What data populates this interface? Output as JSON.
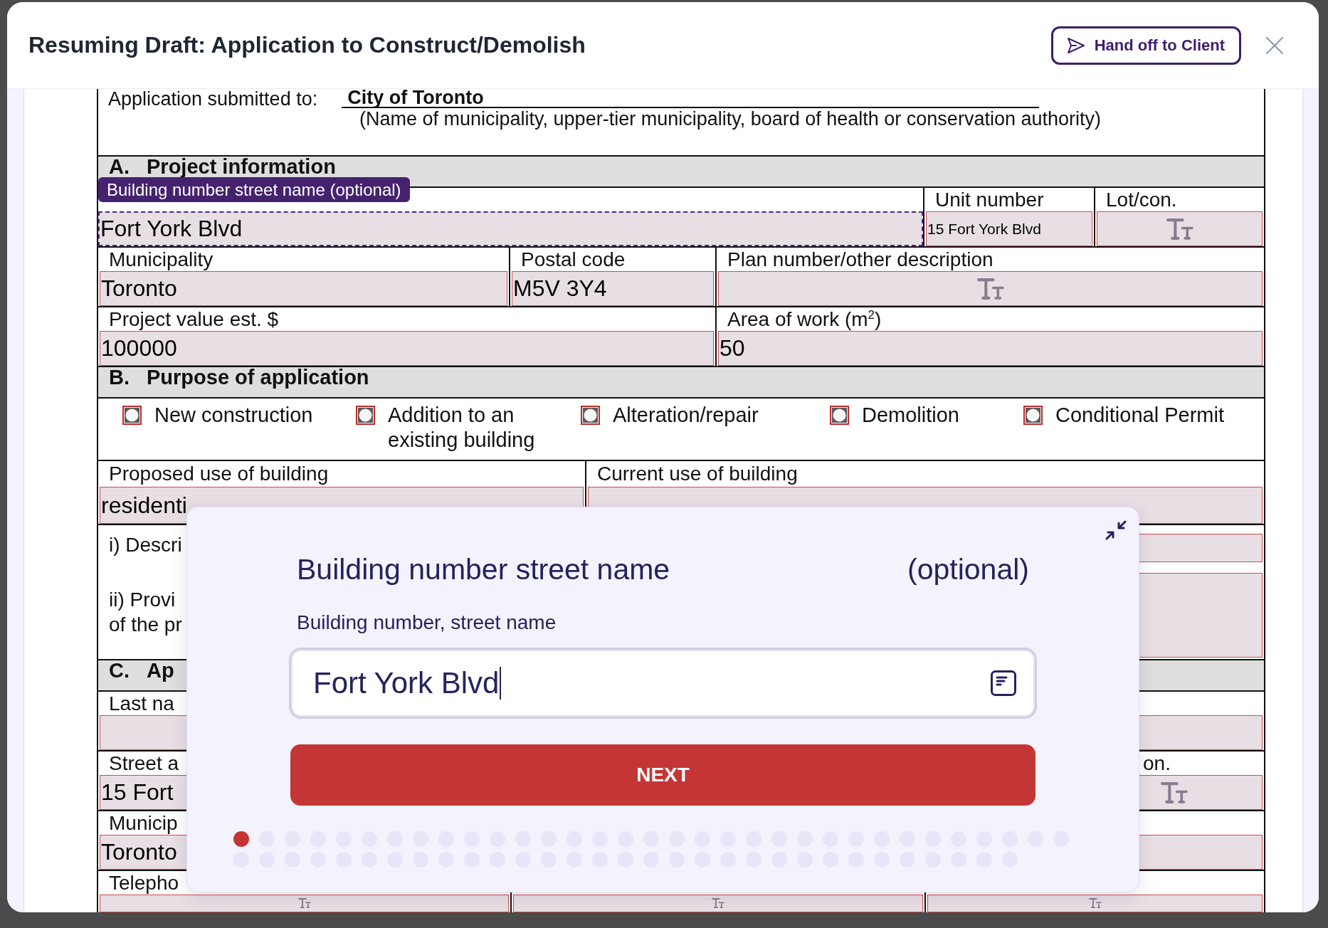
{
  "header": {
    "title": "Resuming Draft: Application to Construct/Demolish",
    "hand_off_button": "Hand off to Client"
  },
  "form": {
    "submitted_to": {
      "label": "Application submitted to:",
      "value": "City of Toronto",
      "note": "(Name of municipality, upper-tier municipality, board of health or conservation authority)"
    },
    "rows": [
      {
        "kind": "section",
        "letter": "A.",
        "title": "Project information"
      },
      {
        "kind": "fields",
        "cells": [
          {
            "value": "Fort York Blvd",
            "focused": true,
            "type_icon": false,
            "tooltip": "Building number street name (optional)"
          },
          {
            "label": "Unit number",
            "value": "15 Fort York Blvd",
            "focused": false,
            "type_icon": false
          },
          {
            "label": "Lot/con.",
            "focused": false,
            "type_icon": true
          }
        ]
      },
      {
        "kind": "fields",
        "cells": [
          {
            "label": "Municipality",
            "value": "Toronto",
            "focused": false,
            "type_icon": false
          },
          {
            "label": "Postal code",
            "value": "M5V 3Y4",
            "focused": false,
            "type_icon": false
          },
          {
            "label": "Plan number/other description",
            "focused": false,
            "type_icon": true
          }
        ]
      },
      {
        "kind": "fields",
        "cells": [
          {
            "label": "Project value est. $",
            "value": "100000",
            "focused": false,
            "type_icon": false
          },
          {
            "label": "Area of work (m$^{2}$)",
            "value": "50",
            "focused": false,
            "type_icon": false
          }
        ]
      },
      {
        "kind": "section",
        "letter": "B.",
        "title": "Purpose of application"
      },
      {
        "kind": "checkboxes",
        "options": [
          {
            "label": "New construction",
            "checked": false
          },
          {
            "label": "Addition to an existing building",
            "checked": false
          },
          {
            "label": "Alteration/repair",
            "checked": false
          },
          {
            "label": "Demolition",
            "checked": false
          },
          {
            "label": "Conditional Permit",
            "checked": false
          }
        ]
      },
      {
        "kind": "fields",
        "cells": [
          {
            "label": "Proposed use of building",
            "value": "residenti",
            "focused": false,
            "type_icon": false
          },
          {
            "label": "Current use of building",
            "focused": false,
            "type_icon": false
          }
        ]
      },
      {
        "kind": "description",
        "items": [
          {
            "lines": [
              "i) Descri"
            ]
          },
          {
            "lines": [
              "ii) Provi",
              "of the pr"
            ]
          }
        ]
      },
      {
        "kind": "section",
        "letter": "C.",
        "title": "Ap"
      },
      {
        "kind": "fields",
        "cells": [
          {
            "label": "Last na",
            "focused": false,
            "type_icon": false
          }
        ]
      },
      {
        "kind": "fields",
        "cells": [
          {
            "label": "Street a",
            "value": "15 Fort",
            "focused": false,
            "type_icon": false
          },
          {
            "label": "on.",
            "focused": false,
            "type_icon": true
          }
        ]
      },
      {
        "kind": "fields",
        "cells": [
          {
            "label": "Municip",
            "value": "Toronto",
            "focused": false,
            "type_icon": false
          },
          {
            "focused": false,
            "type_icon": false
          }
        ]
      },
      {
        "kind": "fields",
        "cells": [
          {
            "label": "Telepho",
            "focused": false,
            "type_icon": true
          },
          {
            "focused": false,
            "type_icon": true
          },
          {
            "focused": false,
            "type_icon": true
          }
        ]
      }
    ]
  },
  "question": {
    "title": "Building number street name",
    "optional": "(optional)",
    "field_label": "Building number, street name",
    "input": {
      "value": "Fort York Blvd",
      "focused": true
    },
    "next_button": "NEXT",
    "steps": [
      {
        "selected": true
      },
      {
        "selected": false
      },
      {
        "selected": false
      },
      {
        "selected": false
      },
      {
        "selected": false
      },
      {
        "selected": false
      },
      {
        "selected": false
      },
      {
        "selected": false
      },
      {
        "selected": false
      },
      {
        "selected": false
      },
      {
        "selected": false
      },
      {
        "selected": false
      },
      {
        "selected": false
      },
      {
        "selected": false
      },
      {
        "selected": false
      },
      {
        "selected": false
      },
      {
        "selected": false
      },
      {
        "selected": false
      },
      {
        "selected": false
      },
      {
        "selected": false
      },
      {
        "selected": false
      },
      {
        "selected": false
      },
      {
        "selected": false
      },
      {
        "selected": false
      },
      {
        "selected": false
      },
      {
        "selected": false
      },
      {
        "selected": false
      },
      {
        "selected": false
      },
      {
        "selected": false
      },
      {
        "selected": false
      },
      {
        "selected": false
      },
      {
        "selected": false
      },
      {
        "selected": false
      },
      {
        "selected": false
      },
      {
        "selected": false
      },
      {
        "selected": false
      },
      {
        "selected": false
      },
      {
        "selected": false
      },
      {
        "selected": false
      },
      {
        "selected": false
      },
      {
        "selected": false
      },
      {
        "selected": false
      },
      {
        "selected": false
      },
      {
        "selected": false
      },
      {
        "selected": false
      },
      {
        "selected": false
      },
      {
        "selected": false
      },
      {
        "selected": false
      },
      {
        "selected": false
      },
      {
        "selected": false
      },
      {
        "selected": false
      },
      {
        "selected": false
      },
      {
        "selected": false
      },
      {
        "selected": false
      },
      {
        "selected": false
      },
      {
        "selected": false
      },
      {
        "selected": false
      },
      {
        "selected": false
      },
      {
        "selected": false
      },
      {
        "selected": false
      },
      {
        "selected": false
      },
      {
        "selected": false
      },
      {
        "selected": false
      },
      {
        "selected": false
      }
    ]
  }
}
